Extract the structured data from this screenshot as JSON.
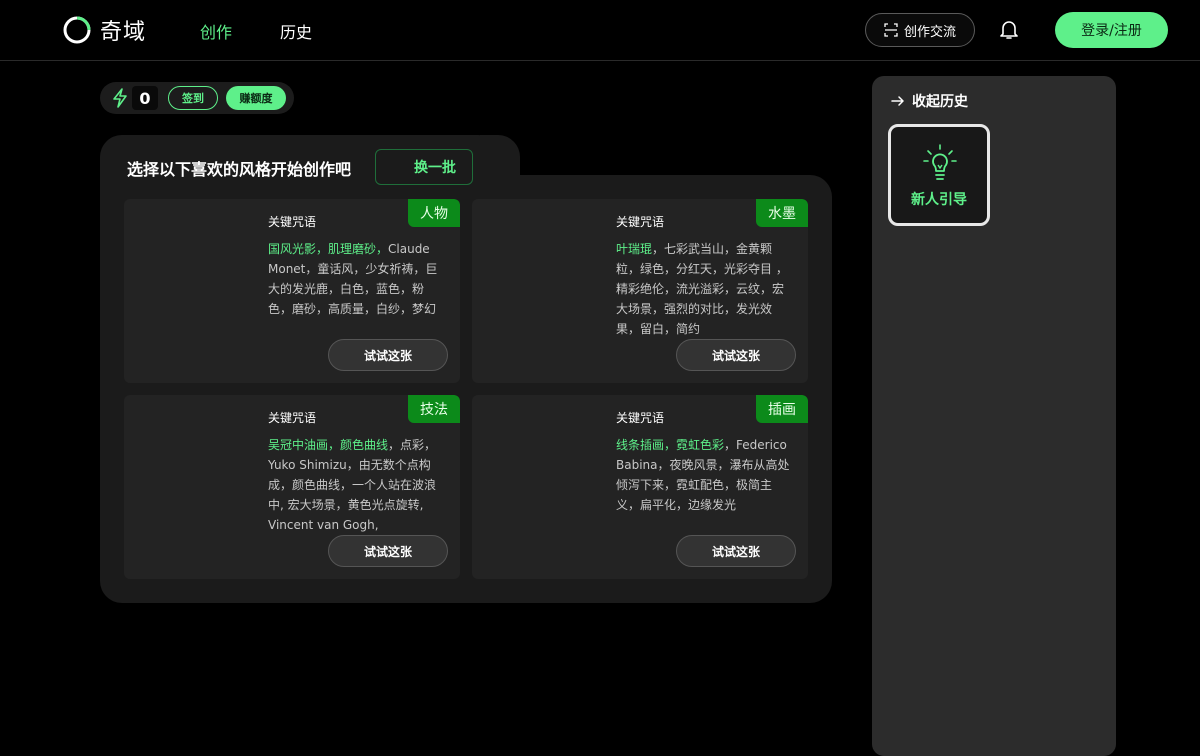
{
  "header": {
    "logo_text": "奇域",
    "nav_create": "创作",
    "nav_history": "历史",
    "community_label": "创作交流",
    "login_label": "登录/注册"
  },
  "status": {
    "credits": "0",
    "checkin_label": "签到",
    "earn_label": "赚额度"
  },
  "panel": {
    "title": "选择以下喜欢的风格开始创作吧",
    "refresh_label": "换一批"
  },
  "cards": [
    {
      "label": "关键咒语",
      "tag": "人物",
      "highlight": "国风光影，肌理磨砂，",
      "text": "Claude Monet，童话风，少女祈祷，巨大的发光鹿，白色，蓝色，粉色，磨砂，高质量，白纱，梦幻",
      "button": "试试这张"
    },
    {
      "label": "关键咒语",
      "tag": "水墨",
      "highlight": "叶瑞琨",
      "text": "，七彩武当山，金黄颗粒，绿色，分红天，光彩夺目 ，精彩绝伦，流光溢彩，云纹，宏大场景，强烈的对比，发光效果，留白，简约",
      "button": "试试这张"
    },
    {
      "label": "关键咒语",
      "tag": "技法",
      "highlight": "吴冠中油画，颜色曲线",
      "text": "，点彩，Yuko Shimizu，由无数个点构成，颜色曲线，一个人站在波浪中, 宏大场景，黄色光点旋转, Vincent van Gogh, pointillism,",
      "button": "试试这张"
    },
    {
      "label": "关键咒语",
      "tag": "插画",
      "highlight": "线条插画，霓虹色彩",
      "text": "，Federico Babina，夜晚风景，瀑布从高处倾泻下来，霓虹配色，极简主义，扁平化，边缘发光",
      "button": "试试这张"
    }
  ],
  "sidebar": {
    "collapse_label": "收起历史",
    "guide_label": "新人引导"
  },
  "colors": {
    "accent": "#5ef08a",
    "tag_bg": "#0c8a1a",
    "panel_bg": "#1b1b1b",
    "sidebar_bg": "#2c2c2c"
  }
}
